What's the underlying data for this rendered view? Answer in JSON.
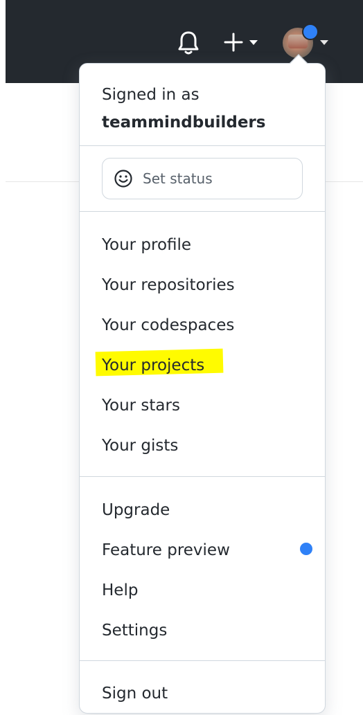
{
  "header": {
    "icons": [
      "bell-icon",
      "plus-icon",
      "caret-down-icon",
      "avatar",
      "caret-down-icon"
    ],
    "avatar_badge_color": "#2f81f7",
    "background": "#24292f"
  },
  "menu": {
    "signed_in_label": "Signed in as",
    "username": "teammindbuilders",
    "set_status_label": "Set status",
    "profile_items": [
      "Your profile",
      "Your repositories",
      "Your codespaces",
      "Your projects",
      "Your stars",
      "Your gists"
    ],
    "misc_items": [
      "Upgrade",
      "Feature preview",
      "Help",
      "Settings"
    ],
    "sign_out_label": "Sign out",
    "highlighted_item": "Your projects",
    "highlight_color": "#fffb00",
    "feature_preview_dot_color": "#2f81f7"
  }
}
